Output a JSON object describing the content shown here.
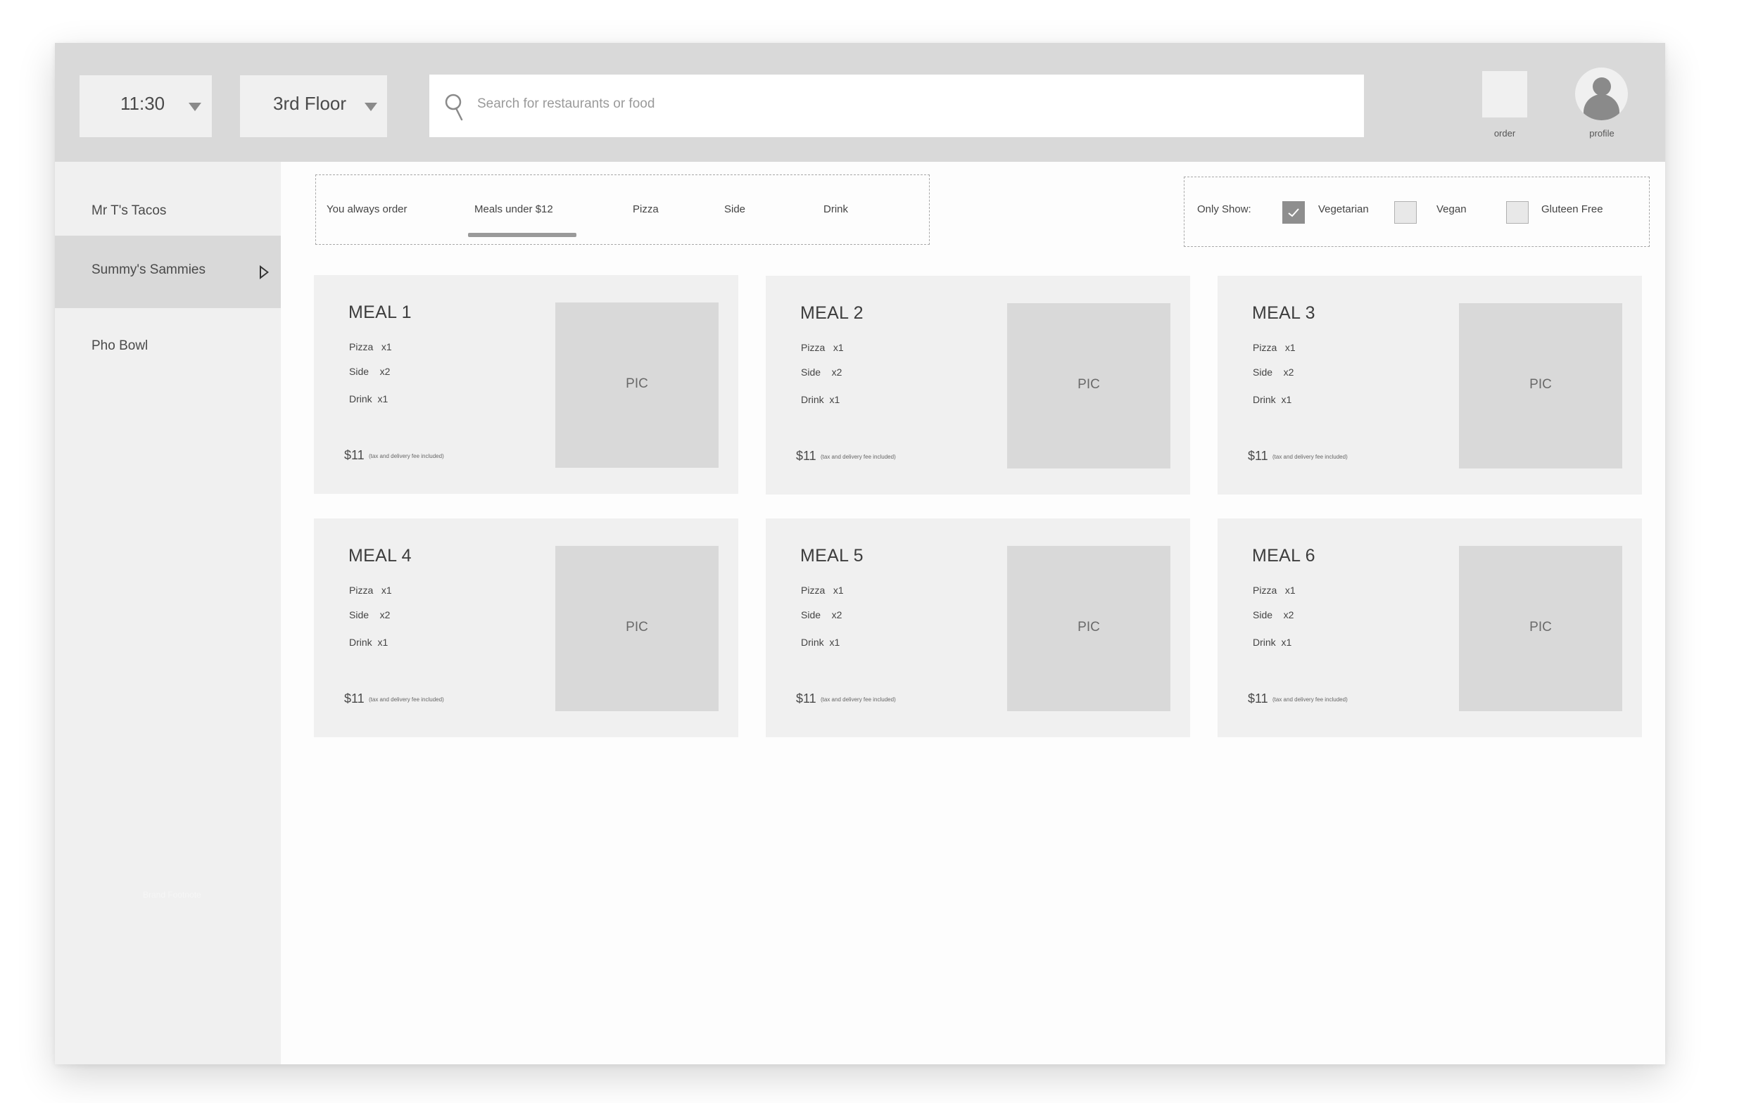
{
  "header": {
    "time": "11:30",
    "floor": "3rd Floor",
    "search_placeholder": "Search for restaurants or food",
    "order_label": "order",
    "profile_label": "profile"
  },
  "sidebar": {
    "items": [
      {
        "label": "Mr T's Tacos",
        "active": false
      },
      {
        "label": "Summy's Sammies",
        "active": true
      },
      {
        "label": "Pho Bowl",
        "active": false
      }
    ],
    "footnote": "Brand Footnote"
  },
  "tabs": {
    "items": [
      "You always order",
      "Meals under $12",
      "Pizza",
      "Side",
      "Drink"
    ],
    "selected": "Meals under $12"
  },
  "filters": {
    "label": "Only Show:",
    "options": [
      {
        "label": "Vegetarian",
        "checked": true
      },
      {
        "label": "Vegan",
        "checked": false
      },
      {
        "label": "Gluteen Free",
        "checked": false
      }
    ]
  },
  "meals": [
    {
      "title": "MEAL 1",
      "items": [
        "Pizza   x1",
        "Side    x2",
        "Drink  x1"
      ],
      "price": "$11",
      "note": "(tax and delivery fee included)",
      "pic": "PIC"
    },
    {
      "title": "MEAL 2",
      "items": [
        "Pizza   x1",
        "Side    x2",
        "Drink  x1"
      ],
      "price": "$11",
      "note": "(tax and delivery fee included)",
      "pic": "PIC"
    },
    {
      "title": "MEAL 3",
      "items": [
        "Pizza   x1",
        "Side    x2",
        "Drink  x1"
      ],
      "price": "$11",
      "note": "(tax and delivery fee included)",
      "pic": "PIC"
    },
    {
      "title": "MEAL 4",
      "items": [
        "Pizza   x1",
        "Side    x2",
        "Drink  x1"
      ],
      "price": "$11",
      "note": "(tax and delivery fee included)",
      "pic": "PIC"
    },
    {
      "title": "MEAL 5",
      "items": [
        "Pizza   x1",
        "Side    x2",
        "Drink  x1"
      ],
      "price": "$11",
      "note": "(tax and delivery fee included)",
      "pic": "PIC"
    },
    {
      "title": "MEAL 6",
      "items": [
        "Pizza   x1",
        "Side    x2",
        "Drink  x1"
      ],
      "price": "$11",
      "note": "(tax and delivery fee included)",
      "pic": "PIC"
    }
  ],
  "icons": {
    "search": "search-icon",
    "dropdown": "chevron-down-icon",
    "profile": "user-avatar-icon",
    "selected_restaurant": "play-arrow-icon",
    "checkbox_checked": "checkmark-icon"
  },
  "colors": {
    "header_bg": "#d9d9d9",
    "panel_bg": "#f0f0f0",
    "pic_bg": "#d9d9d9",
    "text": "#4a4a4a"
  }
}
